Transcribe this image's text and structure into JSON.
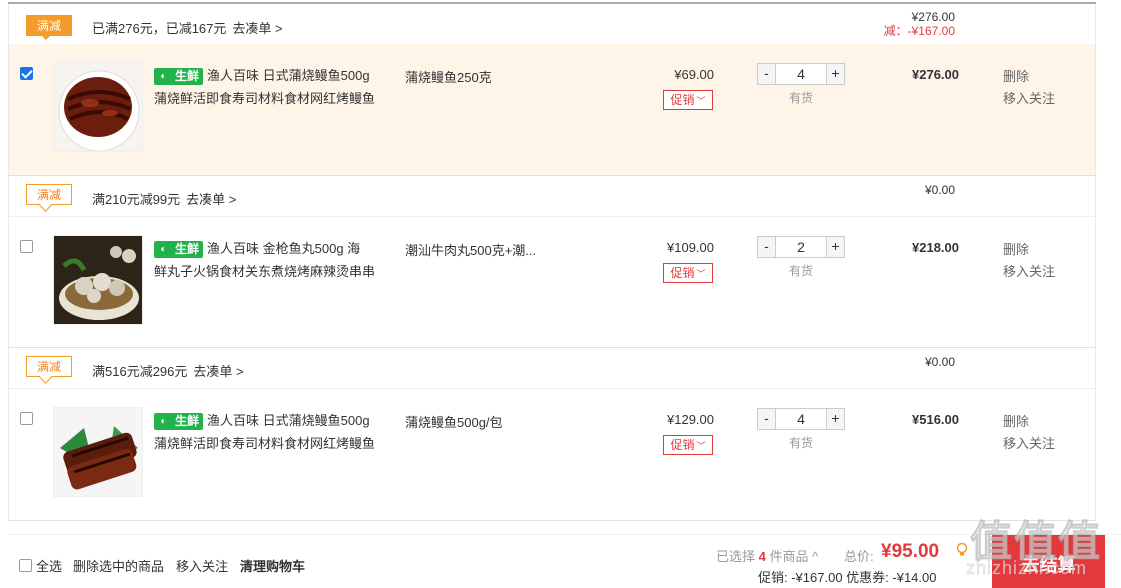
{
  "groups": [
    {
      "tag": "满减",
      "promo_text": "已满276元，已减167元",
      "promo_link": "去凑单 >",
      "sum_total": "¥276.00",
      "sum_reduce": "减：-¥167.00",
      "item": {
        "checked": true,
        "fresh_label": "生鲜",
        "name_line1": "渔人百味 日式蒲烧鳗鱼500g",
        "name_line2": "蒲烧鲜活即食寿司材料食材网红烤鳗鱼",
        "spec": "蒲烧鳗鱼250克",
        "price": "¥69.00",
        "promo_btn": "促销",
        "qty": "4",
        "stock": "有货",
        "subtotal": "¥276.00",
        "op_delete": "删除",
        "op_follow": "移入关注"
      }
    },
    {
      "tag": "满减",
      "promo_text": "满210元减99元",
      "promo_link": "去凑单 >",
      "sum_total": "¥0.00",
      "item": {
        "checked": false,
        "fresh_label": "生鲜",
        "name_line1": "渔人百味 金枪鱼丸500g 海",
        "name_line2": "鲜丸子火锅食材关东煮烧烤麻辣烫串串",
        "spec": "潮汕牛肉丸500克+潮...",
        "price": "¥109.00",
        "promo_btn": "促销",
        "qty": "2",
        "stock": "有货",
        "subtotal": "¥218.00",
        "op_delete": "删除",
        "op_follow": "移入关注"
      }
    },
    {
      "tag": "满减",
      "promo_text": "满516元减296元",
      "promo_link": "去凑单 >",
      "sum_total": "¥0.00",
      "item": {
        "checked": false,
        "fresh_label": "生鲜",
        "name_line1": "渔人百味 日式蒲烧鳗鱼500g",
        "name_line2": "蒲烧鲜活即食寿司材料食材网红烤鳗鱼",
        "spec": "蒲烧鳗鱼500g/包",
        "price": "¥129.00",
        "promo_btn": "促销",
        "qty": "4",
        "stock": "有货",
        "subtotal": "¥516.00",
        "op_delete": "删除",
        "op_follow": "移入关注"
      }
    }
  ],
  "footer": {
    "select_all": "全选",
    "delete_selected": "删除选中的商品",
    "move_follow": "移入关注",
    "clear_cart": "清理购物车",
    "selected_prefix": "已选择",
    "selected_count": "4",
    "selected_suffix": "件商品 ^",
    "total_label": "总价:",
    "total_value": "¥95.00",
    "discount_promo": "促销: -¥167.00",
    "discount_coupon": "优惠券: -¥14.00",
    "checkout": "去结算"
  },
  "watermark": {
    "text": "值值值",
    "site": "zhizhizhi.com"
  },
  "colors": {
    "accent_red": "#e4393c",
    "promo_orange": "#f39c2a",
    "fresh_green": "#21b24b",
    "selected_row_bg": "#fff4e8"
  }
}
